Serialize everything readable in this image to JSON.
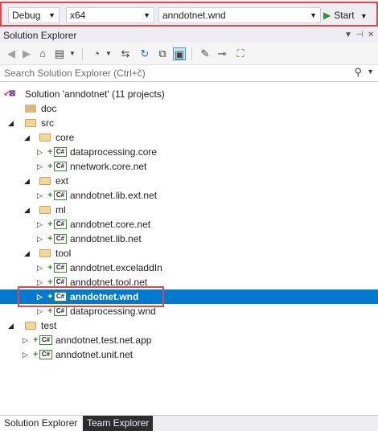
{
  "toolbar": {
    "configuration": "Debug",
    "platform": "x64",
    "startup_project": "anndotnet.wnd",
    "start_label": "Start"
  },
  "panel": {
    "title": "Solution Explorer",
    "search_placeholder": "Search Solution Explorer (Ctrl+č)"
  },
  "tree": {
    "solution": "Solution 'anndotnet' (11 projects)",
    "items": [
      {
        "label": "doc",
        "kind": "folder"
      },
      {
        "label": "src",
        "kind": "folder"
      },
      {
        "label": "core",
        "kind": "folder"
      },
      {
        "label": "dataprocessing.core",
        "kind": "csproj"
      },
      {
        "label": "nnetwork.core.net",
        "kind": "csproj"
      },
      {
        "label": "ext",
        "kind": "folder"
      },
      {
        "label": "anndotnet.lib.ext.net",
        "kind": "csproj"
      },
      {
        "label": "ml",
        "kind": "folder"
      },
      {
        "label": "anndotnet.core.net",
        "kind": "csproj"
      },
      {
        "label": "anndotnet.lib.net",
        "kind": "csproj"
      },
      {
        "label": "tool",
        "kind": "folder"
      },
      {
        "label": "anndotnet.exceladdIn",
        "kind": "csproj"
      },
      {
        "label": "anndotnet.tool.net",
        "kind": "csproj"
      },
      {
        "label": "anndotnet.wnd",
        "kind": "csproj",
        "selected": true
      },
      {
        "label": "dataprocessing.wnd",
        "kind": "csproj"
      },
      {
        "label": "test",
        "kind": "folder"
      },
      {
        "label": "anndotnet.test.net.app",
        "kind": "csproj"
      },
      {
        "label": "anndotnet.unit.net",
        "kind": "csproj"
      }
    ]
  },
  "tabs": [
    "Solution Explorer",
    "Team Explorer"
  ],
  "icons": {
    "back": "back-arrow-icon",
    "forward": "forward-arrow-icon",
    "home": "home-icon",
    "switch_views": "switch-views-icon",
    "history": "pending-changes-icon",
    "sync": "sync-icon",
    "refresh": "refresh-icon",
    "collapse": "collapse-all-icon",
    "show_all": "show-all-files-icon",
    "properties": "wrench-icon",
    "preview": "preview-icon",
    "class_view": "class-diagram-icon",
    "search": "search-icon"
  },
  "colors": {
    "selection": "#0079ce",
    "highlight_box": "#e0464a",
    "start_green": "#388a34",
    "team_tab": "#2d2d30"
  }
}
